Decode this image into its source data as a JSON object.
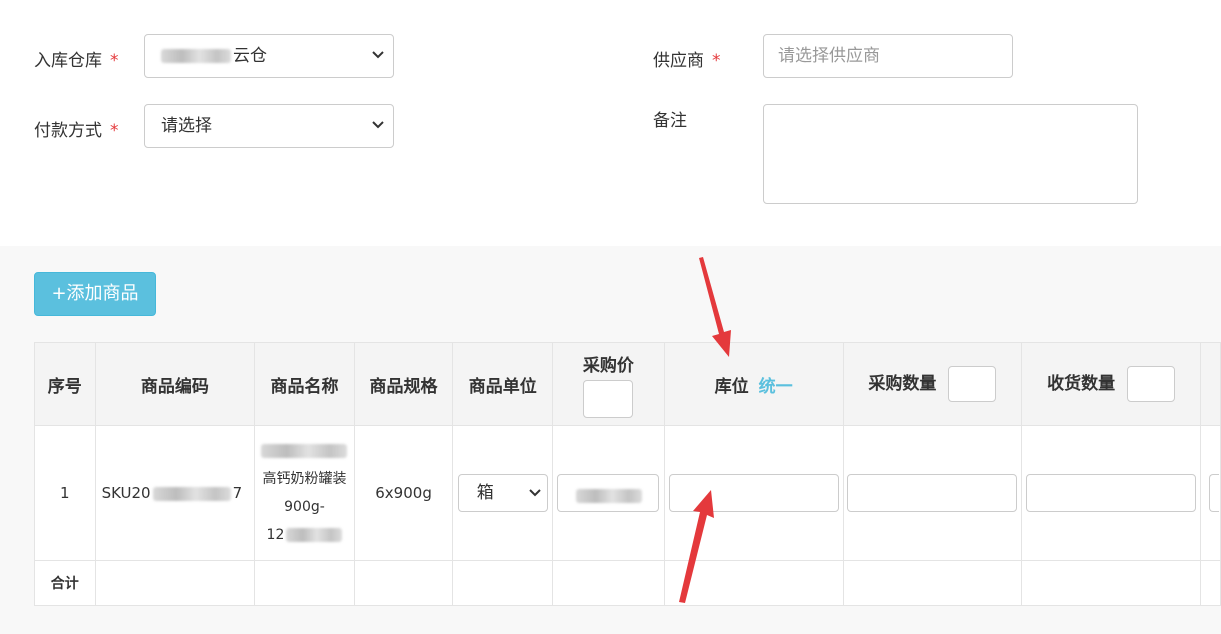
{
  "form": {
    "warehouse_label": "入库仓库",
    "warehouse_value": "云仓",
    "payment_label": "付款方式",
    "payment_value": "请选择",
    "supplier_label": "供应商",
    "supplier_placeholder": "请选择供应商",
    "remark_label": "备注",
    "required_mark": "*"
  },
  "actions": {
    "add_product": "+添加商品"
  },
  "table": {
    "headers": {
      "seq": "序号",
      "code": "商品编码",
      "name": "商品名称",
      "spec": "商品规格",
      "unit": "商品单位",
      "price": "采购价",
      "location": "库位",
      "location_link": "统一",
      "purchase_qty": "采购数量",
      "receive_qty": "收货数量"
    },
    "rows": [
      {
        "seq": "1",
        "code_prefix": "SKU20",
        "code_suffix": "7",
        "name_line1": "高钙奶粉罐装",
        "name_line2": "900g-",
        "name_line3": "12",
        "spec": "6x900g",
        "unit": "箱"
      }
    ],
    "total_label": "合计"
  },
  "colors": {
    "accent": "#5bc0de",
    "required": "#e4393c",
    "arrow": "#e4393c"
  }
}
